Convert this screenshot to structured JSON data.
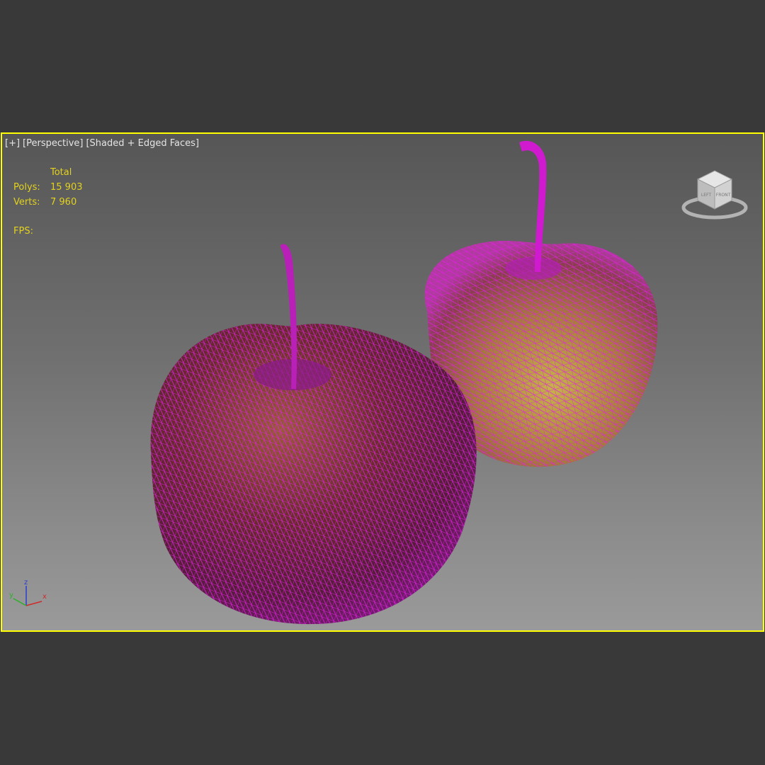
{
  "viewport": {
    "menu_plus": "[+]",
    "view_mode": "[Perspective]",
    "shading_mode": "[Shaded + Edged Faces]"
  },
  "stats": {
    "header": "Total",
    "polys_label": "Polys:",
    "polys_value": "15 903",
    "verts_label": "Verts:",
    "verts_value": "7 960",
    "fps_label": "FPS:"
  },
  "viewcube": {
    "left_face": "LEFT",
    "front_face": "FRONT"
  },
  "axis_gizmo": {
    "x": "x",
    "y": "y",
    "z": "z"
  },
  "colors": {
    "viewport_border": "#ffff00",
    "wire": "#e020e0",
    "stats_text": "#e3d21e"
  }
}
